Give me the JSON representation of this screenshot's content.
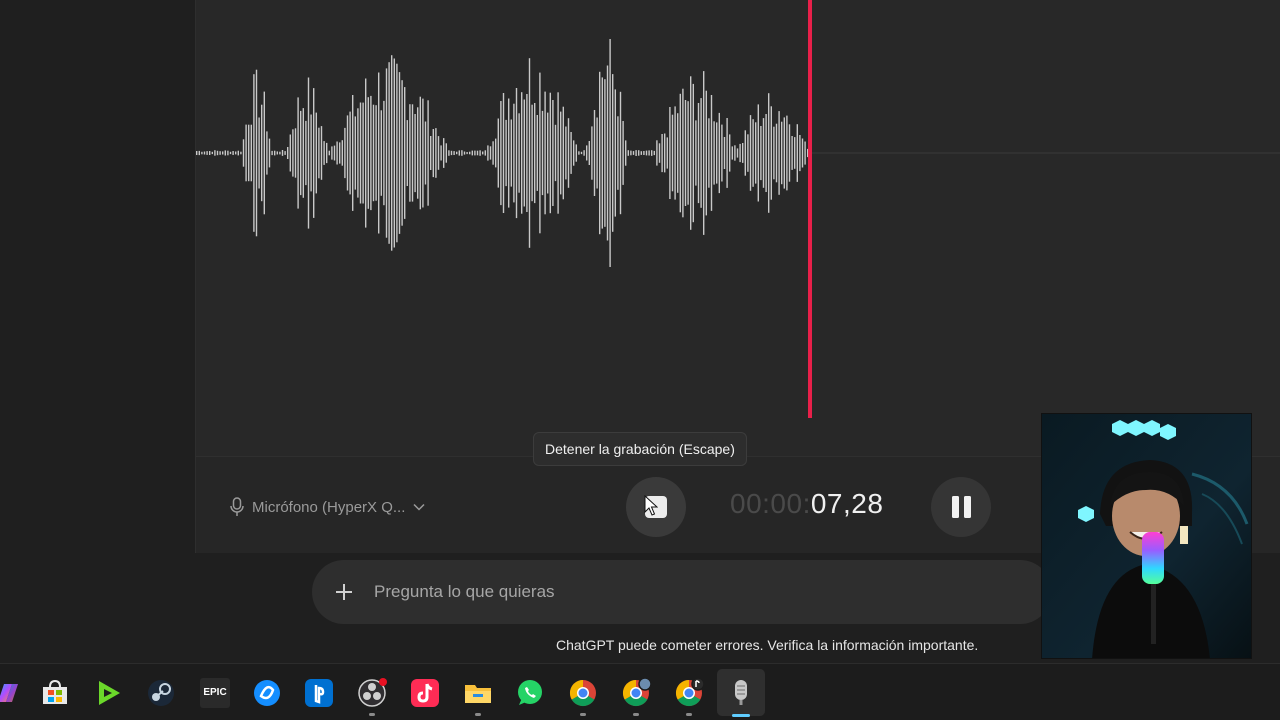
{
  "recorder": {
    "microphone_label": "Micrófono (HyperX Q...",
    "timer_dim": "00:00:",
    "timer_main": "07,28",
    "tooltip": "Detener la grabación (Escape)",
    "playhead_color": "#e8204a"
  },
  "chat": {
    "placeholder": "Pregunta lo que quieras",
    "disclaimer": "ChatGPT puede cometer errores. Verifica la información importante."
  },
  "taskbar": {
    "icons": [
      "copilot-icon",
      "microsoft-store-icon",
      "play-launcher-icon",
      "steam-icon",
      "epic-games-icon",
      "battle-net-icon",
      "playstation-icon",
      "obs-icon",
      "tiktok-icon",
      "file-explorer-icon",
      "whatsapp-icon",
      "chrome-icon",
      "chrome-profile-icon",
      "chrome-profile-2-icon",
      "voice-recorder-icon"
    ],
    "epic_label": "EPIC"
  }
}
